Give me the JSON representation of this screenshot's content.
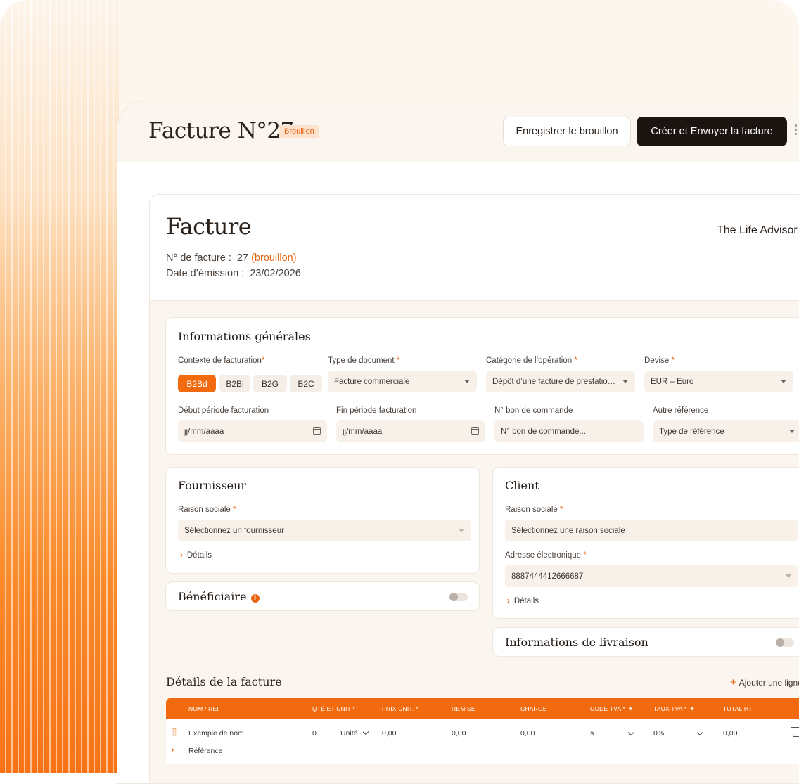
{
  "header": {
    "title": "Facture N°27",
    "status_badge": "Brouillon",
    "save_draft_label": "Enregistrer le brouillon",
    "create_send_label": "Créer et Envoyer la facture"
  },
  "document": {
    "title": "Facture",
    "company": "The Life Advisor",
    "number_label": "N° de facture :",
    "number_value": "27",
    "number_status": "(brouillon)",
    "date_label": "Date d’émission :",
    "date_value": "23/02/2026"
  },
  "general": {
    "title": "Informations générales",
    "context_label": "Contexte de facturation",
    "context_options": [
      "B2Bd",
      "B2Bi",
      "B2G",
      "B2C"
    ],
    "context_selected": "B2Bd",
    "doc_type_label": "Type de document",
    "doc_type_value": "Facture commerciale",
    "category_label": "Catégorie de l’opération",
    "category_value": "Dépôt d’une facture de prestatio…",
    "currency_label": "Devise",
    "currency_value": "EUR – Euro",
    "period_start_label": "Début période facturation",
    "period_start_placeholder": "jj/mm/aaaa",
    "period_end_label": "Fin période facturation",
    "period_end_placeholder": "jj/mm/aaaa",
    "po_label": "N° bon de commande",
    "po_placeholder": "N° bon de commande...",
    "other_ref_label": "Autre référence",
    "other_ref_value": "Type de référence",
    "required_mark": "*"
  },
  "supplier": {
    "title": "Fournisseur",
    "name_label": "Raison sociale",
    "name_placeholder": "Sélectionnez un fournisseur",
    "details_label": "Détails"
  },
  "beneficiary": {
    "title": "Bénéficiaire",
    "info_icon": "i"
  },
  "client": {
    "title": "Client",
    "name_label": "Raison sociale",
    "name_placeholder": "Sélectionnez une raison sociale",
    "email_label": "Adresse électronique",
    "email_value": "8887444412666687",
    "details_label": "Détails"
  },
  "delivery": {
    "title": "Informations de livraison"
  },
  "lines": {
    "title": "Détails de la facture",
    "add_label": "Ajouter une ligne",
    "add_icon": "+",
    "columns": {
      "name": "NOM / REF",
      "qty": "QTÉ ET UNIT",
      "price": "PRIX UNIT.",
      "discount": "REMISE",
      "charge": "CHARGE",
      "vat_code": "CODE TVA",
      "vat_rate": "TAUX TVA",
      "total": "TOTAL HT"
    },
    "spark_icon": "✦",
    "row": {
      "name": "Exemple de nom",
      "qty": "0",
      "unit": "Unité",
      "price": "0,00",
      "discount": "0,00",
      "charge": "0,00",
      "vat_code": "s",
      "vat_rate": "0%",
      "total": "0,00",
      "reference_label": "Référence"
    }
  },
  "colors": {
    "accent": "#f26a10",
    "dark_button": "#1c1410",
    "field_bg": "#f8f1ea"
  }
}
